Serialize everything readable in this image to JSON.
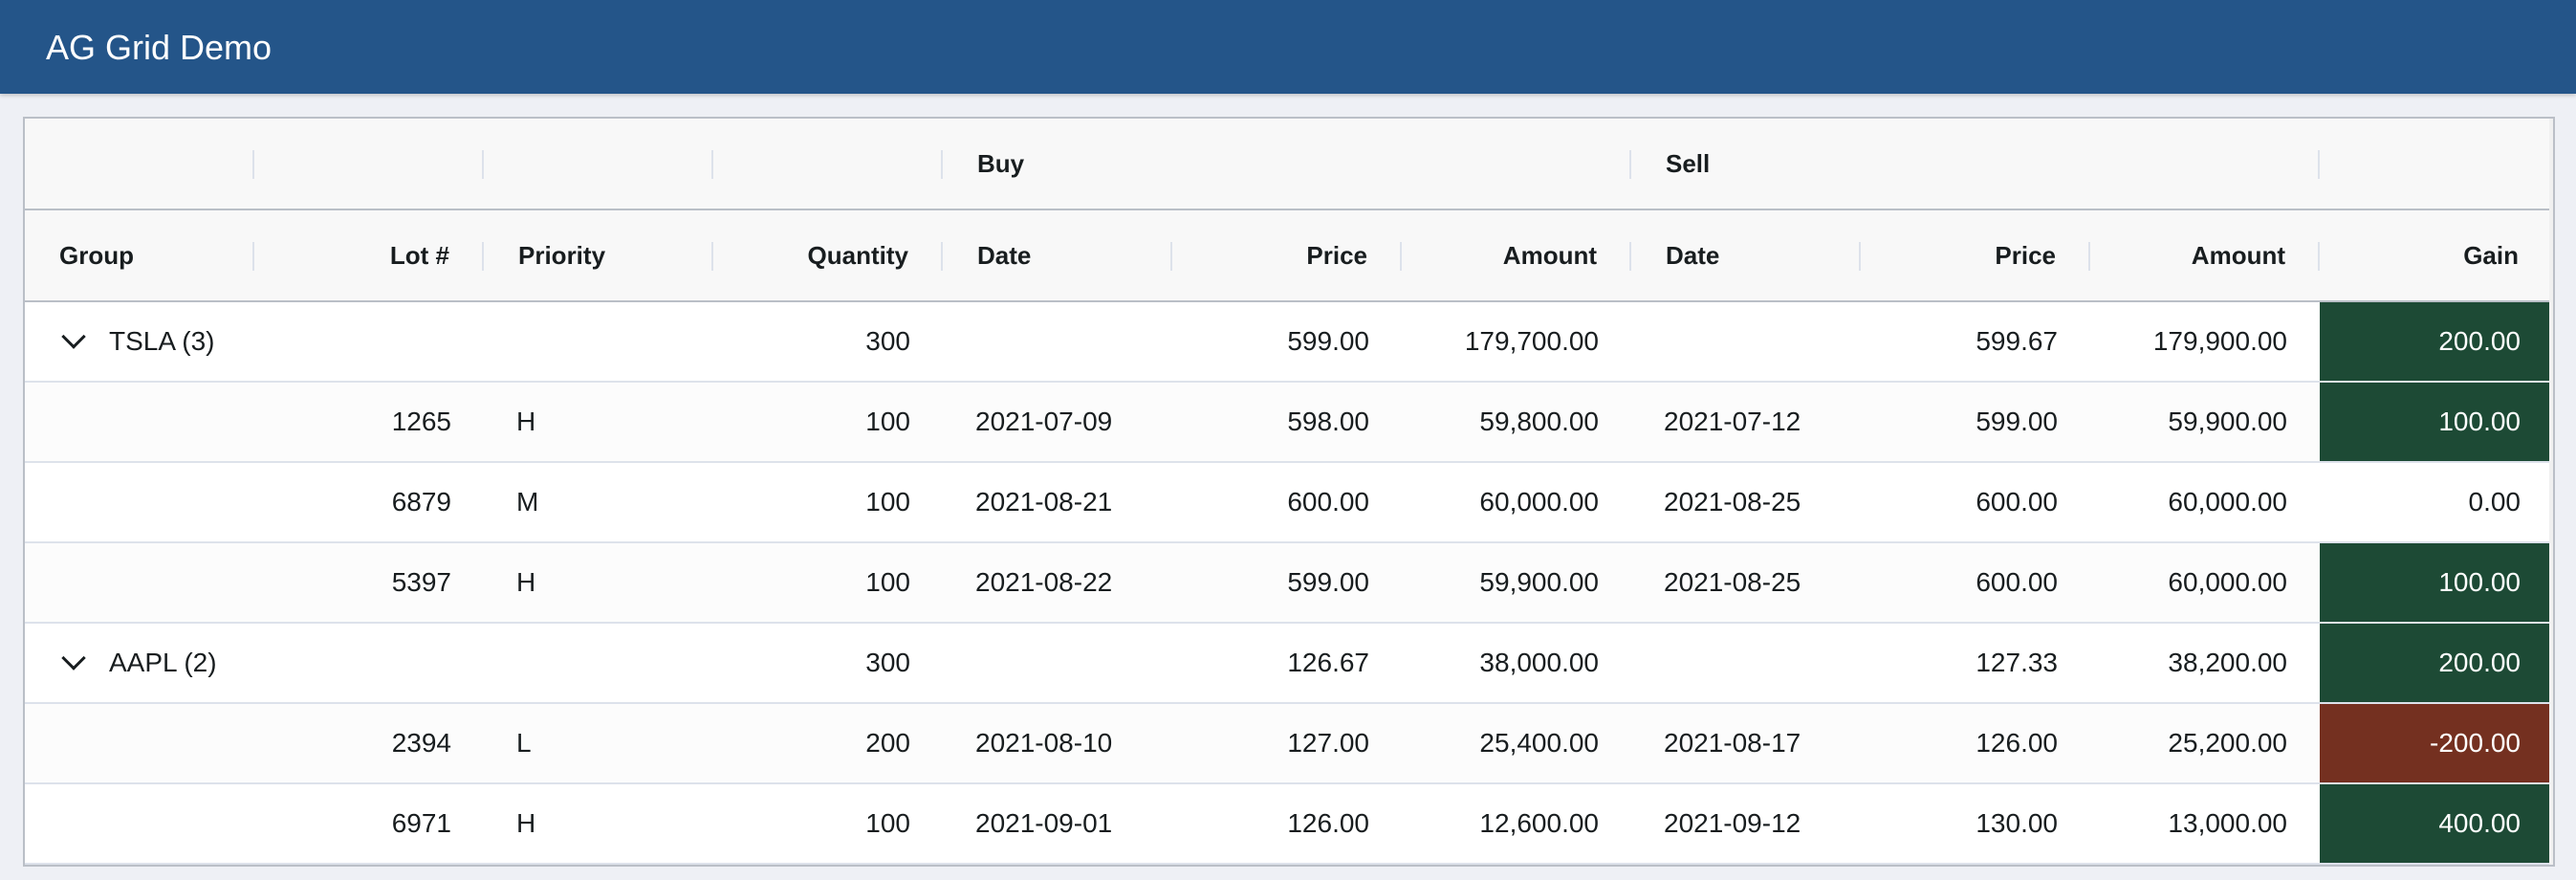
{
  "app": {
    "title": "AG Grid Demo"
  },
  "grid": {
    "group_headers": {
      "buy": "Buy",
      "sell": "Sell"
    },
    "columns": {
      "group": "Group",
      "lot": "Lot #",
      "priority": "Priority",
      "quantity": "Quantity",
      "buy_date": "Date",
      "buy_price": "Price",
      "buy_amount": "Amount",
      "sell_date": "Date",
      "sell_price": "Price",
      "sell_amount": "Amount",
      "gain": "Gain"
    },
    "colors": {
      "header": "#245589",
      "gain_positive": "#1d4a35",
      "gain_negative": "#743020"
    },
    "rows": [
      {
        "group": "TSLA (3)",
        "lot": "",
        "priority": "",
        "quantity": "300",
        "buy_date": "",
        "buy_price": "599.00",
        "buy_amount": "179,700.00",
        "sell_date": "",
        "sell_price": "599.67",
        "sell_amount": "179,900.00",
        "gain": "200.00"
      },
      {
        "group": "",
        "lot": "1265",
        "priority": "H",
        "quantity": "100",
        "buy_date": "2021-07-09",
        "buy_price": "598.00",
        "buy_amount": "59,800.00",
        "sell_date": "2021-07-12",
        "sell_price": "599.00",
        "sell_amount": "59,900.00",
        "gain": "100.00"
      },
      {
        "group": "",
        "lot": "6879",
        "priority": "M",
        "quantity": "100",
        "buy_date": "2021-08-21",
        "buy_price": "600.00",
        "buy_amount": "60,000.00",
        "sell_date": "2021-08-25",
        "sell_price": "600.00",
        "sell_amount": "60,000.00",
        "gain": "0.00"
      },
      {
        "group": "",
        "lot": "5397",
        "priority": "H",
        "quantity": "100",
        "buy_date": "2021-08-22",
        "buy_price": "599.00",
        "buy_amount": "59,900.00",
        "sell_date": "2021-08-25",
        "sell_price": "600.00",
        "sell_amount": "60,000.00",
        "gain": "100.00"
      },
      {
        "group": "AAPL (2)",
        "lot": "",
        "priority": "",
        "quantity": "300",
        "buy_date": "",
        "buy_price": "126.67",
        "buy_amount": "38,000.00",
        "sell_date": "",
        "sell_price": "127.33",
        "sell_amount": "38,200.00",
        "gain": "200.00"
      },
      {
        "group": "",
        "lot": "2394",
        "priority": "L",
        "quantity": "200",
        "buy_date": "2021-08-10",
        "buy_price": "127.00",
        "buy_amount": "25,400.00",
        "sell_date": "2021-08-17",
        "sell_price": "126.00",
        "sell_amount": "25,200.00",
        "gain": "-200.00"
      },
      {
        "group": "",
        "lot": "6971",
        "priority": "H",
        "quantity": "100",
        "buy_date": "2021-09-01",
        "buy_price": "126.00",
        "buy_amount": "12,600.00",
        "sell_date": "2021-09-12",
        "sell_price": "130.00",
        "sell_amount": "13,000.00",
        "gain": "400.00"
      }
    ]
  }
}
